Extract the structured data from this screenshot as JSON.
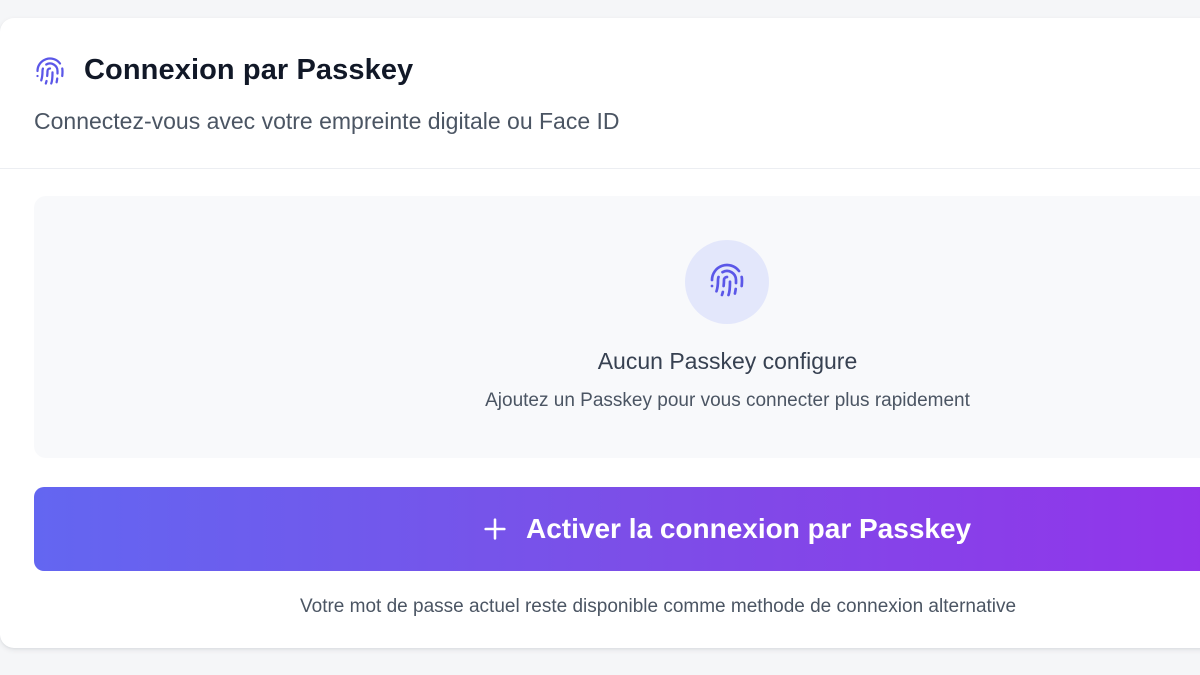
{
  "header": {
    "title": "Connexion par Passkey",
    "subtitle": "Connectez-vous avec votre empreinte digitale ou Face ID",
    "icon": "fingerprint-icon"
  },
  "empty_state": {
    "icon": "fingerprint-icon",
    "title": "Aucun Passkey configure",
    "description": "Ajoutez un Passkey pour vous connecter plus rapidement"
  },
  "cta": {
    "label": "Activer la connexion par Passkey",
    "icon": "plus-icon"
  },
  "footnote": "Votre mot de passe actuel reste disponible comme methode de connexion alternative",
  "colors": {
    "accent": "#5b57e8",
    "gradient_start": "#6366f1",
    "gradient_end": "#9333ea",
    "icon_circle_bg": "#e3e7fb"
  }
}
